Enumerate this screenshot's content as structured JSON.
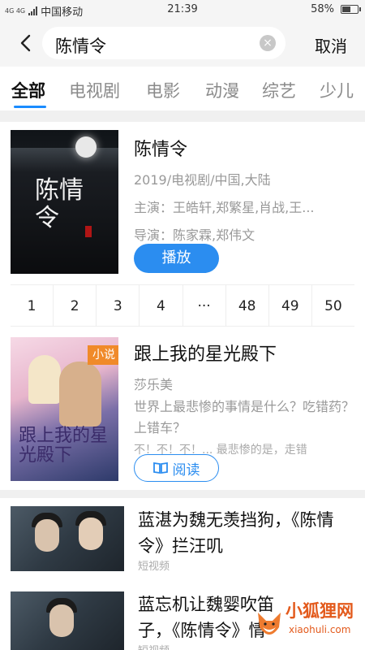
{
  "status_bar": {
    "network": "4G 4G",
    "carrier": "中国移动",
    "time": "21:39",
    "battery": "58%",
    "battery_level": 0.58
  },
  "search": {
    "query": "陈情令",
    "cancel_label": "取消"
  },
  "tabs": [
    {
      "label": "全部",
      "active": true
    },
    {
      "label": "电视剧",
      "active": false
    },
    {
      "label": "电影",
      "active": false
    },
    {
      "label": "动漫",
      "active": false
    },
    {
      "label": "综艺",
      "active": false
    },
    {
      "label": "少儿",
      "active": false
    }
  ],
  "results": {
    "drama": {
      "title": "陈情令",
      "poster_text": "陈情令",
      "meta": "2019/电视剧/中国,大陆",
      "cast": "主演：王皓轩,郑繁星,肖战,王...",
      "director": "导演：陈家霖,郑伟文",
      "play_label": "播放",
      "episodes": [
        "1",
        "2",
        "3",
        "4",
        "···",
        "48",
        "49",
        "50"
      ]
    },
    "novel": {
      "badge": "小说",
      "poster_text": "跟上我的星光殿下",
      "title": "跟上我的星光殿下",
      "author": "莎乐美",
      "description": "世界上最悲惨的事情是什么？吃错药？上错车？",
      "description_more": "不！不！不！... 最悲惨的是，走错",
      "read_label": "阅读"
    },
    "videos": [
      {
        "title": "蓝湛为魏无羡挡狗，《陈情令》拦汪叽",
        "type": "短视频"
      },
      {
        "title": "蓝忘机让魏婴吹笛子，《陈情令》",
        "title_extra": "情",
        "type": "短视频"
      }
    ]
  },
  "watermark": {
    "name": "小狐狸网",
    "url": "xiaohuli.com"
  },
  "colors": {
    "accent": "#2b8df0",
    "tab_underline": "#1a8cff",
    "watermark": "#e35a1c"
  }
}
